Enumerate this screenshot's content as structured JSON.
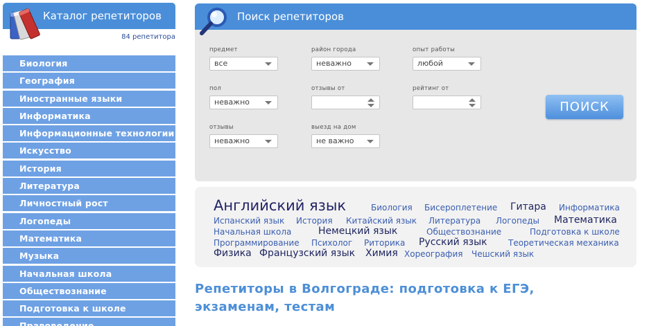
{
  "sidebar": {
    "title": "Каталог репетиторов",
    "count": "84 репетитора",
    "items": [
      {
        "label": "Биология"
      },
      {
        "label": "География"
      },
      {
        "label": "Иностранные языки"
      },
      {
        "label": "Информатика"
      },
      {
        "label": "Информационные технологии"
      },
      {
        "label": "Искусство"
      },
      {
        "label": "История"
      },
      {
        "label": "Литература"
      },
      {
        "label": "Личностный рост"
      },
      {
        "label": "Логопеды"
      },
      {
        "label": "Математика"
      },
      {
        "label": "Музыка"
      },
      {
        "label": "Начальная школа"
      },
      {
        "label": "Обществознание"
      },
      {
        "label": "Подготовка к школе"
      },
      {
        "label": "Правоведение"
      }
    ]
  },
  "search": {
    "title": "Поиск репетиторов",
    "button": "ПОИСК",
    "fields": {
      "subject": {
        "label": "предмет",
        "value": "все"
      },
      "district": {
        "label": "район города",
        "value": "неважно"
      },
      "experience": {
        "label": "опыт работы",
        "value": "любой"
      },
      "gender": {
        "label": "пол",
        "value": "неважно"
      },
      "reviews_from": {
        "label": "отзывы от",
        "value": ""
      },
      "rating_from": {
        "label": "рейтинг от",
        "value": ""
      },
      "reviews": {
        "label": "отзывы",
        "value": "неважно"
      },
      "home_visit": {
        "label": "выезд на дом",
        "value": "не важно"
      }
    }
  },
  "tags": [
    "Английский язык",
    "Биология",
    "Бисероплетение",
    "Гитара",
    "Информатика",
    "Испанский язык",
    "История",
    "Китайский язык",
    "Литература",
    "Логопеды",
    "Математика",
    "Начальная школа",
    "Немецкий язык",
    "Обществознание",
    "Подготовка к школе",
    "Программирование",
    "Психолог",
    "Риторика",
    "Русский язык",
    "Теоретическая механика",
    "Физика",
    "Французский язык",
    "Химия",
    "Хореография",
    "Чешский язык"
  ],
  "heading": "Репетиторы в Волгограде: подготовка к ЕГЭ, экзаменам, тестам",
  "colors": {
    "accent": "#4a8ed9",
    "sidebar_item": "#6ea1e4",
    "panel": "#e7e7e7",
    "heading": "#4d8fd6"
  },
  "icons": {
    "sidebar": "books-icon",
    "search": "magnifier-icon"
  }
}
